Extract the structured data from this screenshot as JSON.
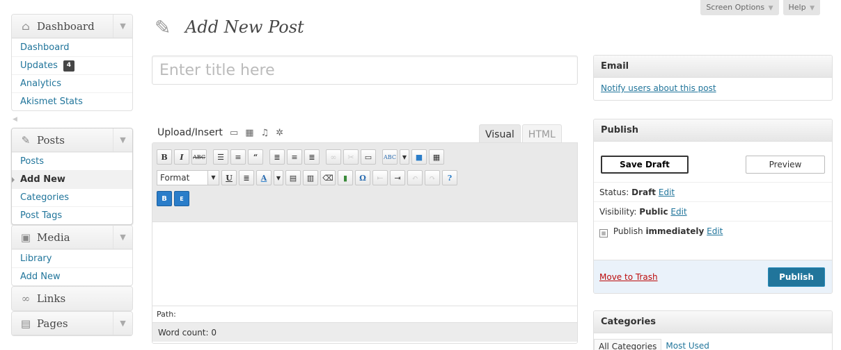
{
  "screen_meta": {
    "screen_options": "Screen Options",
    "help": "Help"
  },
  "sidebar": {
    "dashboard": {
      "label": "Dashboard",
      "items": [
        "Dashboard",
        "Updates",
        "Analytics",
        "Akismet Stats"
      ],
      "updates_count": "4"
    },
    "posts": {
      "label": "Posts",
      "items": [
        "Posts",
        "Add New",
        "Categories",
        "Post Tags"
      ],
      "current": "Add New"
    },
    "media": {
      "label": "Media",
      "items": [
        "Library",
        "Add New"
      ]
    },
    "links": {
      "label": "Links"
    },
    "pages": {
      "label": "Pages"
    }
  },
  "page": {
    "title": "Add New Post"
  },
  "post_title": {
    "placeholder": "Enter title here"
  },
  "upload": {
    "label": "Upload/Insert"
  },
  "editor": {
    "tabs": {
      "visual": "Visual",
      "html": "HTML"
    },
    "format_label": "Format",
    "path_label": "Path:",
    "word_count": "Word count: 0"
  },
  "email_box": {
    "title": "Email",
    "link": "Notify users about this post"
  },
  "publish_box": {
    "title": "Publish",
    "save_draft": "Save Draft",
    "preview": "Preview",
    "status_label": "Status:",
    "status_value": "Draft",
    "visibility_label": "Visibility:",
    "visibility_value": "Public",
    "publish_label": "Publish",
    "publish_value": "immediately",
    "edit": "Edit",
    "trash": "Move to Trash",
    "publish_button": "Publish"
  },
  "categories_box": {
    "title": "Categories",
    "tab_all": "All Categories",
    "tab_most": "Most Used"
  }
}
